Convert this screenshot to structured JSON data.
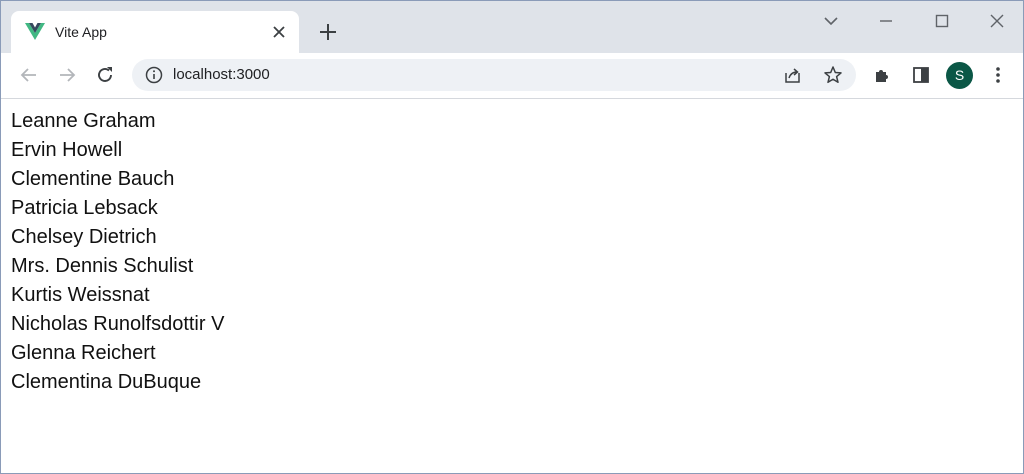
{
  "tab": {
    "title": "Vite App"
  },
  "omnibox": {
    "url": "localhost:3000"
  },
  "profile": {
    "initial": "S",
    "color": "#0b5746"
  },
  "colors": {
    "vite_logo_primary": "#41b883",
    "vite_logo_dark": "#35495e"
  },
  "users": [
    "Leanne Graham",
    "Ervin Howell",
    "Clementine Bauch",
    "Patricia Lebsack",
    "Chelsey Dietrich",
    "Mrs. Dennis Schulist",
    "Kurtis Weissnat",
    "Nicholas Runolfsdottir V",
    "Glenna Reichert",
    "Clementina DuBuque"
  ]
}
